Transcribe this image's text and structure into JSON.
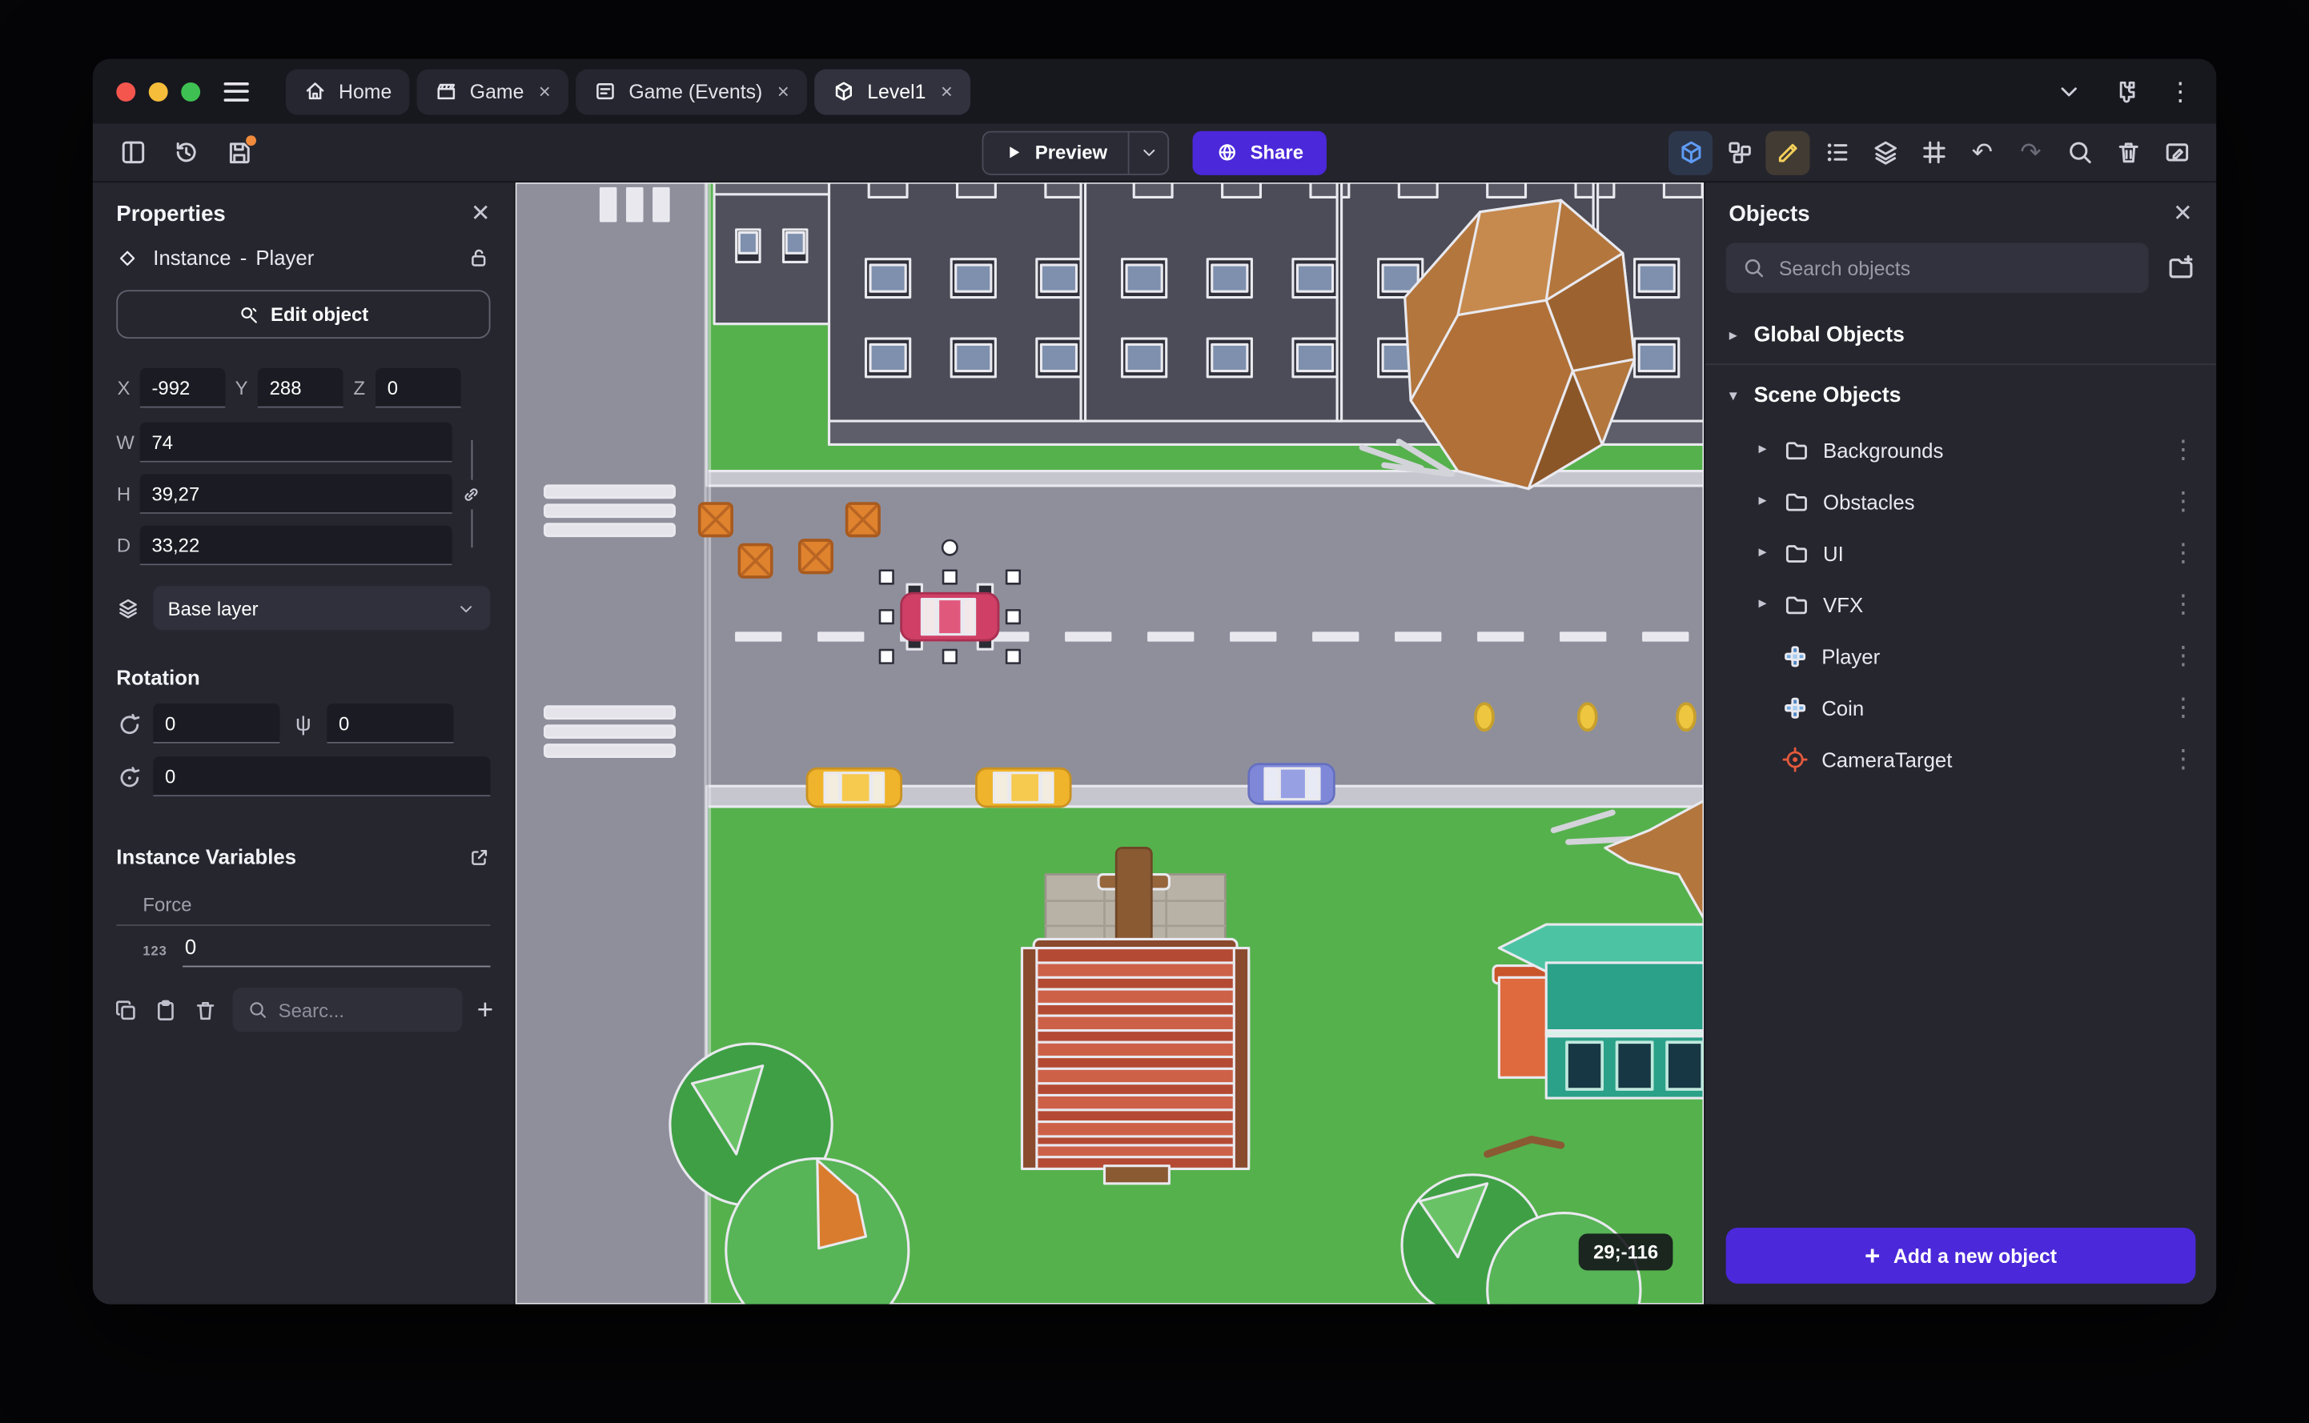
{
  "window": {
    "tabs": [
      {
        "label": "Home"
      },
      {
        "label": "Game"
      },
      {
        "label": "Game (Events)"
      },
      {
        "label": "Level1"
      }
    ],
    "close_glyph": "×"
  },
  "toolbar": {
    "preview_label": "Preview",
    "share_label": "Share"
  },
  "properties": {
    "title": "Properties",
    "instance_type": "Instance",
    "separator": "-",
    "instance_name": "Player",
    "edit_object_label": "Edit object",
    "x_label": "X",
    "x": "-992",
    "y_label": "Y",
    "y": "288",
    "z_label": "Z",
    "z": "0",
    "w_label": "W",
    "w": "74",
    "h_label": "H",
    "h": "39,27",
    "d_label": "D",
    "d": "33,22",
    "layer": "Base layer",
    "rotation_title": "Rotation",
    "rot_x": "0",
    "rot_y": "0",
    "rot_z": "0",
    "psi_glyph": "ψ",
    "variables_title": "Instance Variables",
    "variable_name": "Force",
    "variable_type": "123",
    "variable_value": "0",
    "search_placeholder": "Searc..."
  },
  "objects": {
    "title": "Objects",
    "search_placeholder": "Search objects",
    "global_group": "Global Objects",
    "scene_group": "Scene Objects",
    "folders": [
      {
        "label": "Backgrounds"
      },
      {
        "label": "Obstacles"
      },
      {
        "label": "UI"
      },
      {
        "label": "VFX"
      }
    ],
    "items": [
      {
        "label": "Player"
      },
      {
        "label": "Coin"
      },
      {
        "label": "CameraTarget"
      }
    ],
    "add_button": "Add a new object",
    "kebab_glyph": "⋮"
  },
  "canvas": {
    "coordinates": "29;-116"
  },
  "colors": {
    "accent_purple": "#4b28d9",
    "active_tool_blue": "#5f9bf5",
    "active_tool_yellow": "#f3cf5a",
    "unsaved_badge_orange": "#f08a3c",
    "selection_handle": "#ffffff"
  }
}
